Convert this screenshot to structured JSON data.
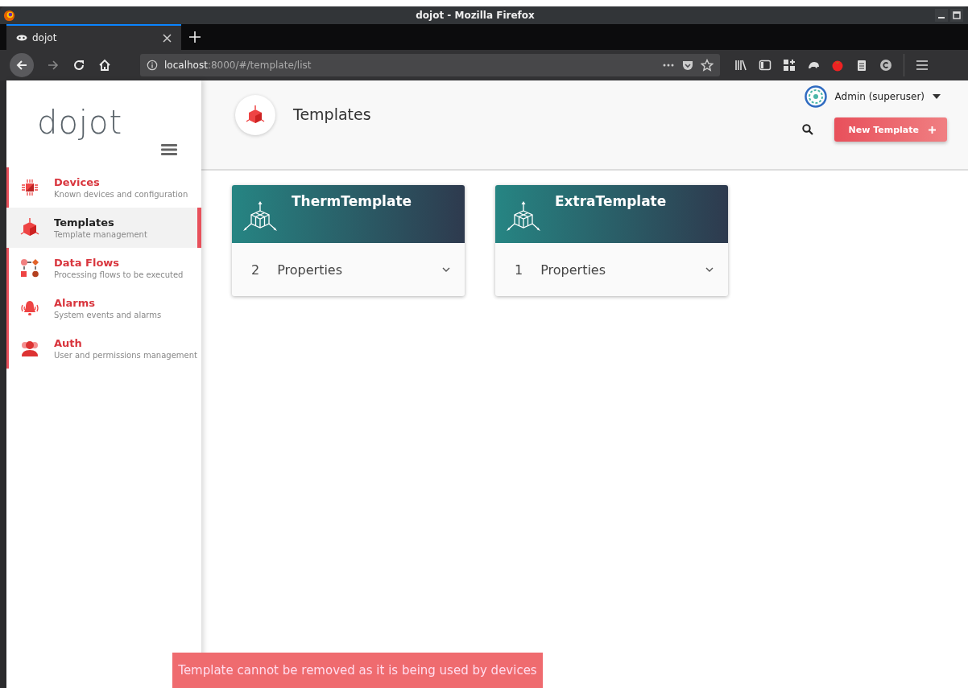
{
  "window": {
    "title": "dojot - Mozilla Firefox"
  },
  "tabs": [
    {
      "label": "dojot",
      "selected": true
    }
  ],
  "address_bar": {
    "host": "localhost",
    "path": ":8000/#/template/list"
  },
  "sidebar": {
    "logo": "dojot",
    "items": [
      {
        "label": "Devices",
        "sublabel": "Known devices and configuration",
        "selected": false
      },
      {
        "label": "Templates",
        "sublabel": "Template management",
        "selected": true
      },
      {
        "label": "Data Flows",
        "sublabel": "Processing flows to be executed",
        "selected": false
      },
      {
        "label": "Alarms",
        "sublabel": "System events and alarms",
        "selected": false
      },
      {
        "label": "Auth",
        "sublabel": "User and permissions management",
        "selected": false
      }
    ]
  },
  "header": {
    "title": "Templates",
    "user": "Admin (superuser)",
    "button": "New Template"
  },
  "cards": [
    {
      "title": "ThermTemplate",
      "count": "2",
      "label": "Properties"
    },
    {
      "title": "ExtraTemplate",
      "count": "1",
      "label": "Properties"
    }
  ],
  "toast": "Template cannot be removed as it is being used by devices"
}
